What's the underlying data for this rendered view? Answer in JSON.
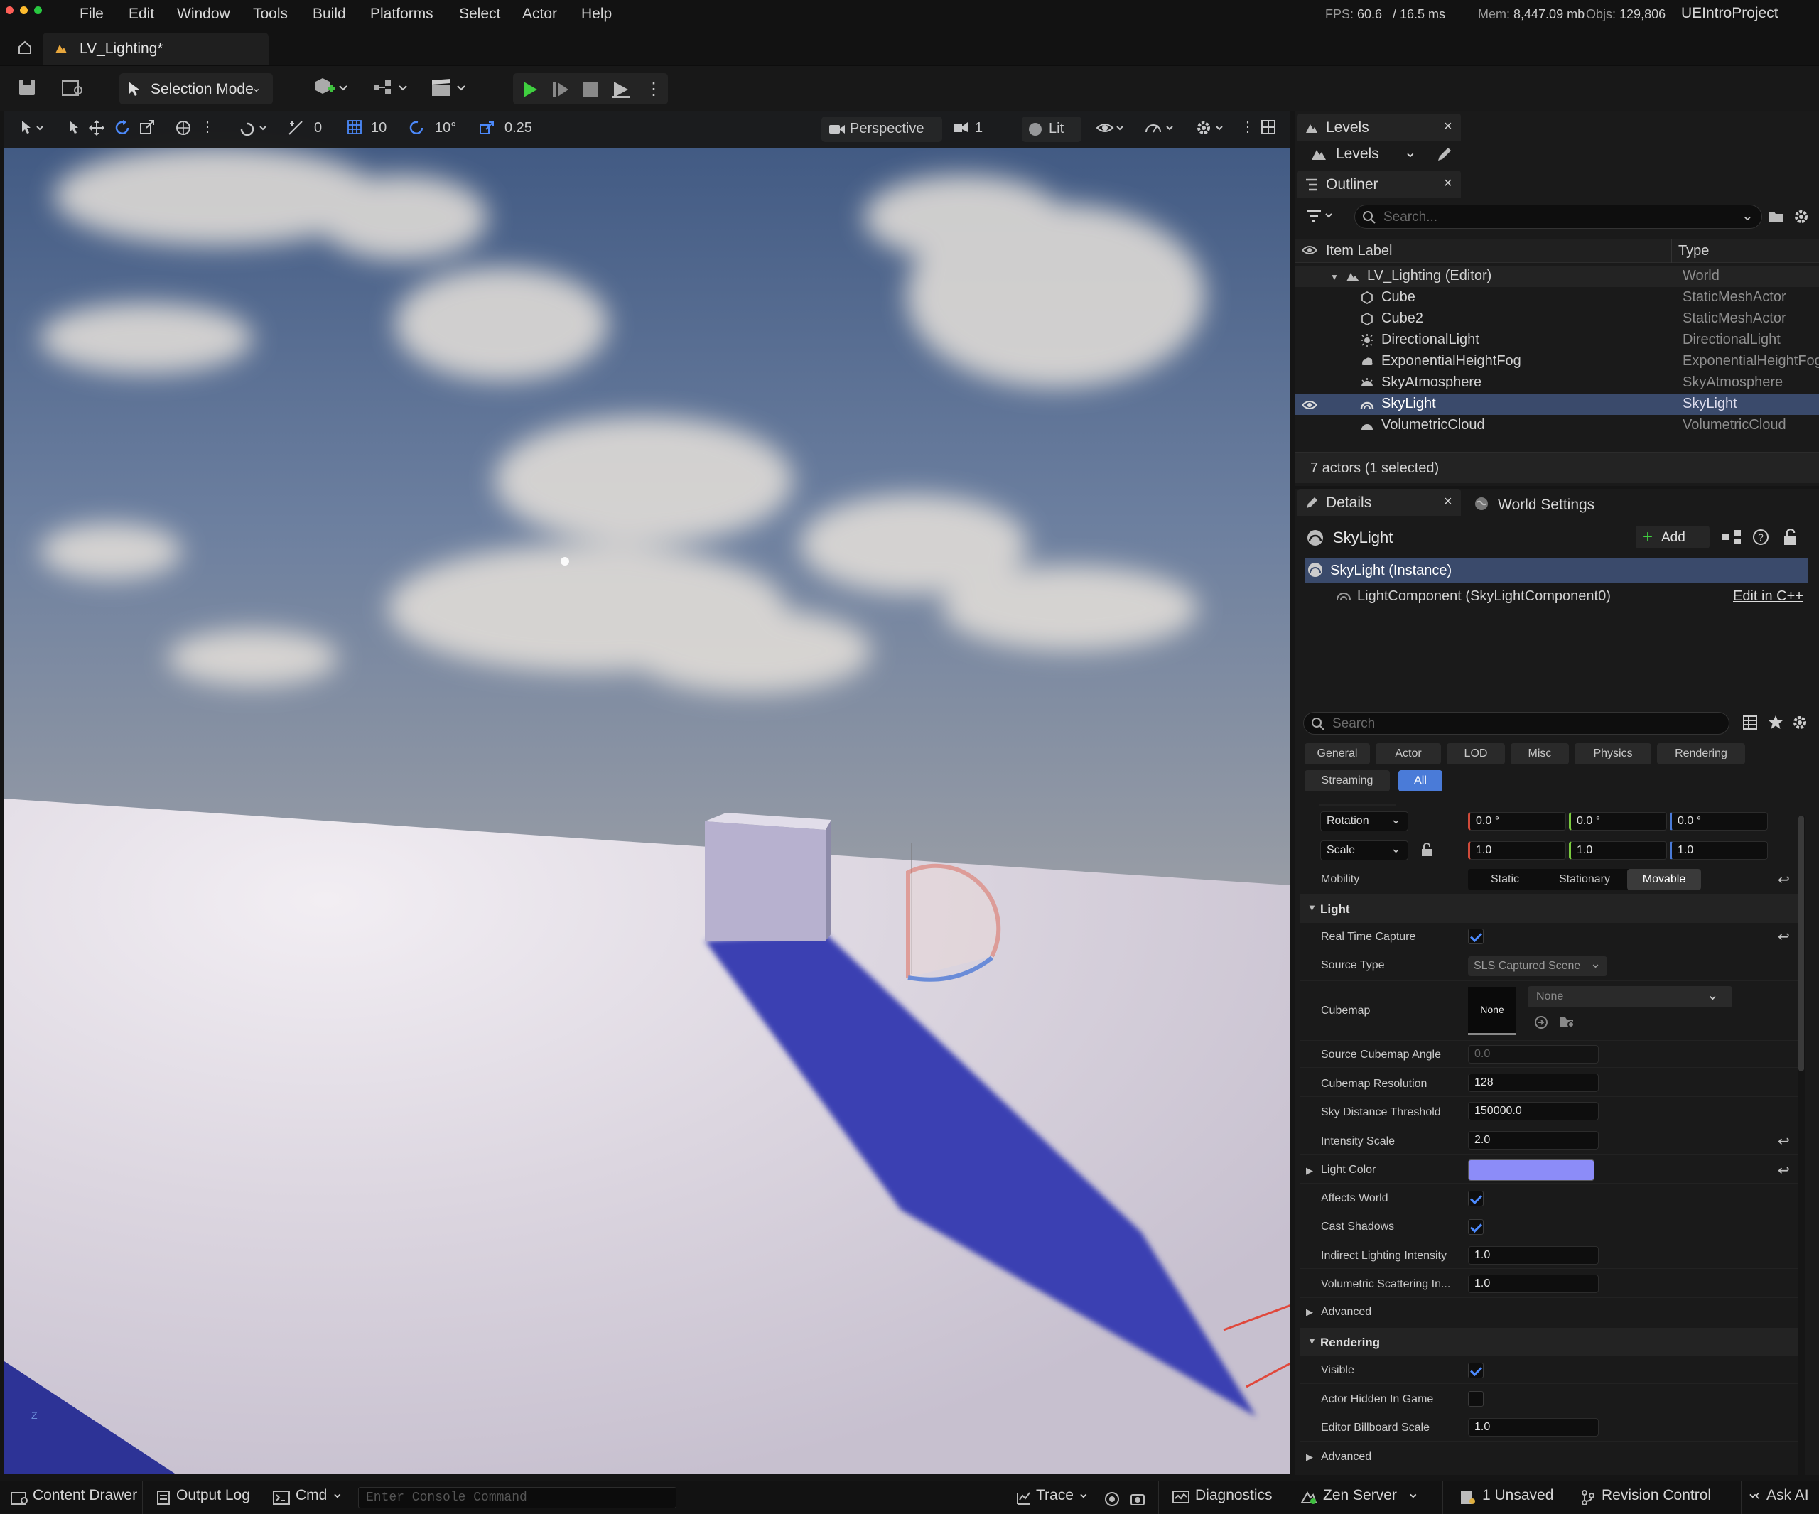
{
  "menu": {
    "items": [
      "File",
      "Edit",
      "Window",
      "Tools",
      "Build",
      "Platforms",
      "Select",
      "Actor",
      "Help"
    ]
  },
  "stats": {
    "fps_label": "FPS:",
    "fps": "60.6",
    "ms": "/  16.5 ms",
    "mem_label": "Mem:",
    "mem": "8,447.09 mb",
    "objs_label": "Objs:",
    "objs": "129,806",
    "project": "UEIntroProject"
  },
  "document_tab": {
    "title": "LV_Lighting*"
  },
  "toolbar": {
    "selection_mode": "Selection Mode"
  },
  "viewport_toolbar": {
    "rotate_snap": "0",
    "grid_snap": "10",
    "angle_snap": "10°",
    "scale_snap": "0.25",
    "view_mode": "Perspective",
    "camera_speed": "1",
    "lit": "Lit"
  },
  "levels": {
    "title": "Levels",
    "dropdown": "Levels"
  },
  "outliner": {
    "title": "Outliner",
    "search_placeholder": "Search...",
    "col_label": "Item Label",
    "col_type": "Type",
    "rows": [
      {
        "label": "LV_Lighting (Editor)",
        "type": "World"
      },
      {
        "label": "Cube",
        "type": "StaticMeshActor"
      },
      {
        "label": "Cube2",
        "type": "StaticMeshActor"
      },
      {
        "label": "DirectionalLight",
        "type": "DirectionalLight"
      },
      {
        "label": "ExponentialHeightFog",
        "type": "ExponentialHeightFog"
      },
      {
        "label": "SkyAtmosphere",
        "type": "SkyAtmosphere"
      },
      {
        "label": "SkyLight",
        "type": "SkyLight"
      },
      {
        "label": "VolumetricCloud",
        "type": "VolumetricCloud"
      }
    ],
    "footer": "7 actors (1 selected)"
  },
  "details": {
    "title": "Details",
    "world_settings": "World Settings",
    "actor_name": "SkyLight",
    "add_label": "Add",
    "instance": "SkyLight (Instance)",
    "component": "LightComponent (SkyLightComponent0)",
    "edit_cpp": "Edit in C++",
    "search_placeholder": "Search",
    "filters": [
      "General",
      "Actor",
      "LOD",
      "Misc",
      "Physics",
      "Rendering",
      "Streaming",
      "All"
    ],
    "transform": {
      "rotation_label": "Rotation",
      "rotation": [
        "0.0 °",
        "0.0 °",
        "0.0 °"
      ],
      "scale_label": "Scale",
      "scale": [
        "1.0",
        "1.0",
        "1.0"
      ]
    },
    "mobility": {
      "label": "Mobility",
      "options": [
        "Static",
        "Stationary",
        "Movable"
      ],
      "selected": "Movable"
    },
    "light_section": "Light",
    "props": {
      "real_time_capture": "Real Time Capture",
      "source_type": "Source Type",
      "source_type_value": "SLS Captured Scene",
      "cubemap": "Cubemap",
      "cubemap_thumb": "None",
      "cubemap_value": "None",
      "source_cubemap_angle": "Source Cubemap Angle",
      "source_cubemap_angle_value": "0.0",
      "cubemap_resolution": "Cubemap Resolution",
      "cubemap_resolution_value": "128",
      "sky_distance_threshold": "Sky Distance Threshold",
      "sky_distance_threshold_value": "150000.0",
      "intensity_scale": "Intensity Scale",
      "intensity_scale_value": "2.0",
      "light_color": "Light Color",
      "light_color_hex": "#8c8cf8",
      "affects_world": "Affects World",
      "cast_shadows": "Cast Shadows",
      "indirect_lighting_intensity": "Indirect Lighting Intensity",
      "indirect_lighting_intensity_value": "1.0",
      "volumetric_scattering": "Volumetric Scattering In...",
      "volumetric_scattering_value": "1.0"
    },
    "advanced": "Advanced",
    "rendering_section": "Rendering",
    "rendering": {
      "visible": "Visible",
      "actor_hidden": "Actor Hidden In Game",
      "billboard_scale": "Editor Billboard Scale",
      "billboard_scale_value": "1.0"
    },
    "advanced2": "Advanced"
  },
  "bottom": {
    "content_drawer": "Content Drawer",
    "output_log": "Output Log",
    "cmd": "Cmd",
    "console_placeholder": "Enter Console Command",
    "trace": "Trace",
    "diagnostics": "Diagnostics",
    "zen_server": "Zen Server",
    "unsaved": "1 Unsaved",
    "revision_control": "Revision Control",
    "ask_ai": "Ask AI"
  },
  "colors": {
    "accent": "#4a7bd8",
    "selected_row": "#3a4a6b",
    "shadow": "#3a3fb0",
    "floor": "#dcd7e2",
    "sky_top": "#3f5a85"
  }
}
